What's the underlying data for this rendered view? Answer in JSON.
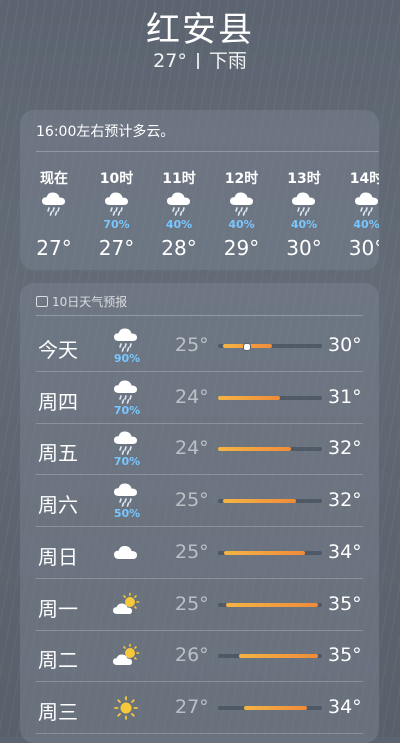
{
  "location": {
    "city": "红安县",
    "temperature": "27°",
    "condition": "下雨"
  },
  "hourly": {
    "summary": "16:00左右预计多云。",
    "items": [
      {
        "time": "现在",
        "icon": "rain-cloud-icon",
        "precip": "",
        "temp": "27°"
      },
      {
        "time": "10时",
        "icon": "rain-cloud-icon",
        "precip": "70%",
        "temp": "27°"
      },
      {
        "time": "11时",
        "icon": "rain-cloud-icon",
        "precip": "40%",
        "temp": "28°"
      },
      {
        "time": "12时",
        "icon": "rain-cloud-icon",
        "precip": "40%",
        "temp": "29°"
      },
      {
        "time": "13时",
        "icon": "rain-cloud-icon",
        "precip": "40%",
        "temp": "30°"
      },
      {
        "time": "14时",
        "icon": "rain-cloud-icon",
        "precip": "40%",
        "temp": "30°"
      }
    ]
  },
  "daily": {
    "title": "10日天气预报",
    "days": [
      {
        "name": "今天",
        "icon": "rain-cloud-icon",
        "precip": "90%",
        "low": "25°",
        "high": "30°",
        "range_start": 0.05,
        "range_end": 0.52,
        "current": 0.27
      },
      {
        "name": "周四",
        "icon": "rain-cloud-icon",
        "precip": "70%",
        "low": "24°",
        "high": "31°",
        "range_start": 0.0,
        "range_end": 0.6,
        "current": null
      },
      {
        "name": "周五",
        "icon": "rain-cloud-icon",
        "precip": "70%",
        "low": "24°",
        "high": "32°",
        "range_start": 0.0,
        "range_end": 0.7,
        "current": null
      },
      {
        "name": "周六",
        "icon": "rain-cloud-icon",
        "precip": "50%",
        "low": "25°",
        "high": "32°",
        "range_start": 0.05,
        "range_end": 0.75,
        "current": null
      },
      {
        "name": "周日",
        "icon": "cloud-icon",
        "precip": "",
        "low": "25°",
        "high": "34°",
        "range_start": 0.06,
        "range_end": 0.84,
        "current": null
      },
      {
        "name": "周一",
        "icon": "partly-cloudy-icon",
        "precip": "",
        "low": "25°",
        "high": "35°",
        "range_start": 0.08,
        "range_end": 0.96,
        "current": null
      },
      {
        "name": "周二",
        "icon": "partly-cloudy-icon",
        "precip": "",
        "low": "26°",
        "high": "35°",
        "range_start": 0.2,
        "range_end": 0.96,
        "current": null
      },
      {
        "name": "周三",
        "icon": "sun-icon",
        "precip": "",
        "low": "27°",
        "high": "34°",
        "range_start": 0.25,
        "range_end": 0.86,
        "current": null
      }
    ]
  },
  "colors": {
    "precip": "#79c7ff",
    "bar_start": "#f4b544",
    "bar_end": "#f08b3a"
  }
}
